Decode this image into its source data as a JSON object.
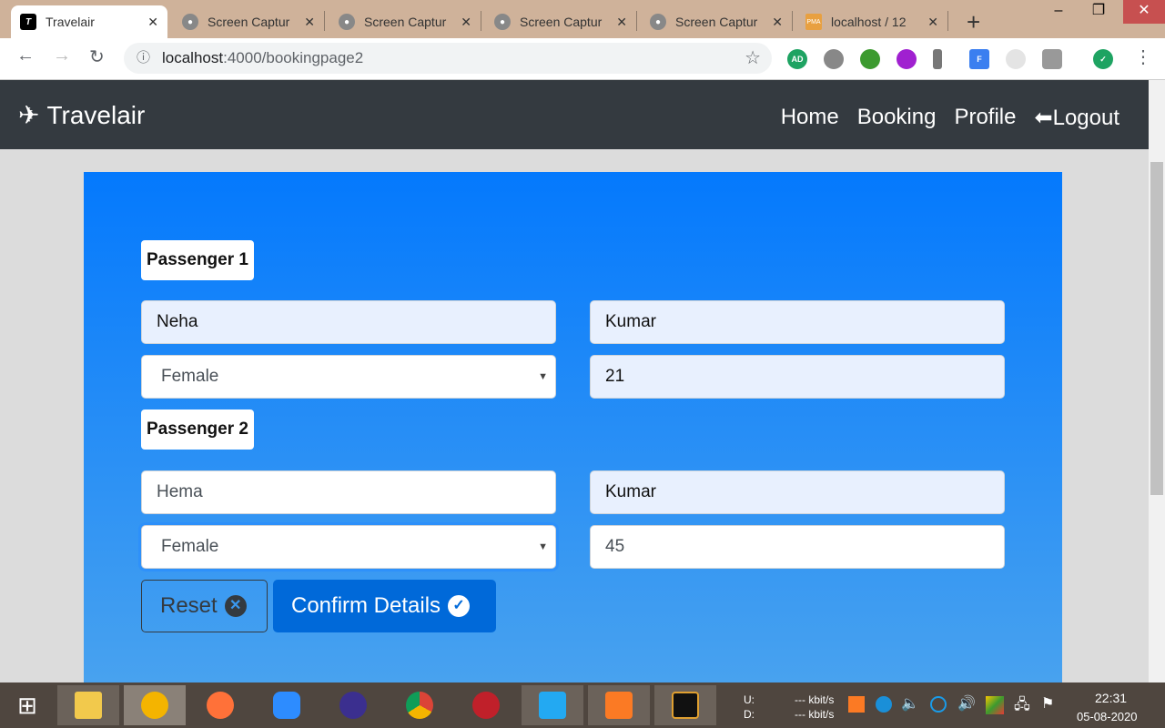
{
  "browser": {
    "tabs": [
      {
        "label": "Travelair",
        "active": true
      },
      {
        "label": "Screen Captur"
      },
      {
        "label": "Screen Captur"
      },
      {
        "label": "Screen Captur"
      },
      {
        "label": "Screen Captur"
      },
      {
        "label": "localhost / 12"
      }
    ],
    "new_tab": "+",
    "url_host": "localhost",
    "url_path": ":4000/bookingpage2"
  },
  "navbar": {
    "brand": "Travelair",
    "links": [
      "Home",
      "Booking",
      "Profile",
      "Logout"
    ]
  },
  "form": {
    "passengers": [
      {
        "label": "Passenger 1",
        "first_name": "Neha",
        "last_name": "Kumar",
        "gender": "Female",
        "age": "21"
      },
      {
        "label": "Passenger 2",
        "first_name": "Hema",
        "last_name": "Kumar",
        "gender": "Female",
        "age": "45"
      }
    ],
    "reset_label": "Reset",
    "confirm_label": "Confirm Details"
  },
  "taskbar": {
    "upload": "U:",
    "download": "D:",
    "up_rate": "--- kbit/s",
    "down_rate": "--- kbit/s",
    "time": "22:31",
    "date": "05-08-2020"
  }
}
